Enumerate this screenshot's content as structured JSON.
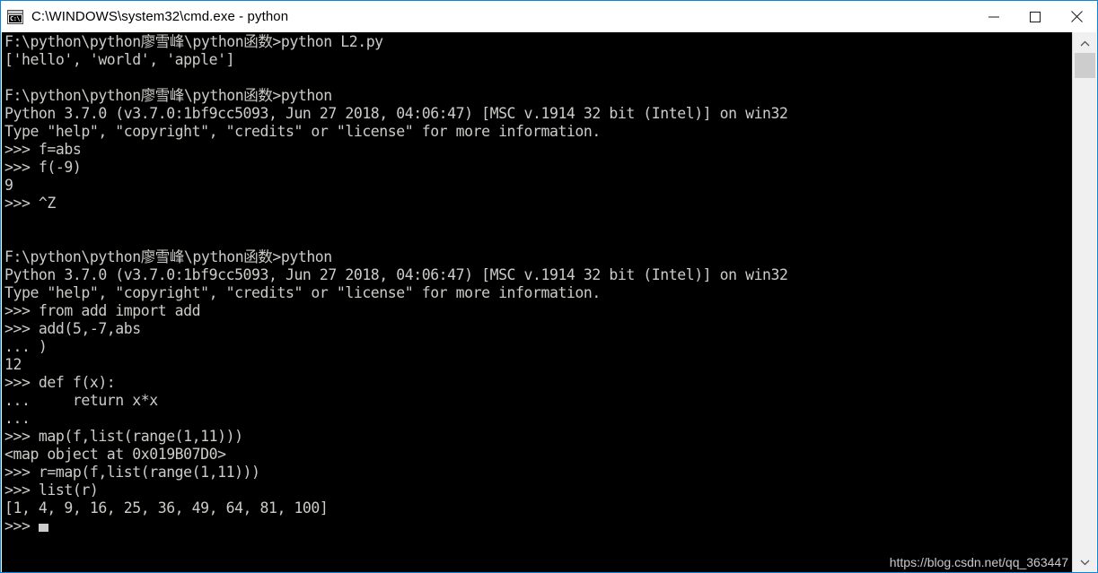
{
  "window": {
    "title": "C:\\WINDOWS\\system32\\cmd.exe - python",
    "icon_label": "C:\\.",
    "border_color": "#0a85d9",
    "controls": {
      "minimize_label": "Minimize",
      "maximize_label": "Maximize",
      "close_label": "Close"
    }
  },
  "console": {
    "background_color": "#000000",
    "text_color": "#ccccc8",
    "lines": [
      "F:\\python\\python廖雪峰\\python函数>python L2.py",
      "['hello', 'world', 'apple']",
      "",
      "F:\\python\\python廖雪峰\\python函数>python",
      "Python 3.7.0 (v3.7.0:1bf9cc5093, Jun 27 2018, 04:06:47) [MSC v.1914 32 bit (Intel)] on win32",
      "Type \"help\", \"copyright\", \"credits\" or \"license\" for more information.",
      ">>> f=abs",
      ">>> f(-9)",
      "9",
      ">>> ^Z",
      "",
      "",
      "F:\\python\\python廖雪峰\\python函数>python",
      "Python 3.7.0 (v3.7.0:1bf9cc5093, Jun 27 2018, 04:06:47) [MSC v.1914 32 bit (Intel)] on win32",
      "Type \"help\", \"copyright\", \"credits\" or \"license\" for more information.",
      ">>> from add import add",
      ">>> add(5,-7,abs",
      "... )",
      "12",
      ">>> def f(x):",
      "...     return x*x",
      "...",
      ">>> map(f,list(range(1,11)))",
      "<map object at 0x019B07D0>",
      ">>> r=map(f,list(range(1,11)))",
      ">>> list(r)",
      "[1, 4, 9, 16, 25, 36, 49, 64, 81, 100]"
    ],
    "prompt_line": ">>> ",
    "cursor_visible": true
  },
  "watermark": {
    "text": "https://blog.csdn.net/qq_363447"
  },
  "scrollbar": {
    "up_icon": "chevron-up-icon",
    "down_icon": "chevron-down-icon",
    "thumb_position_percent": 4
  }
}
